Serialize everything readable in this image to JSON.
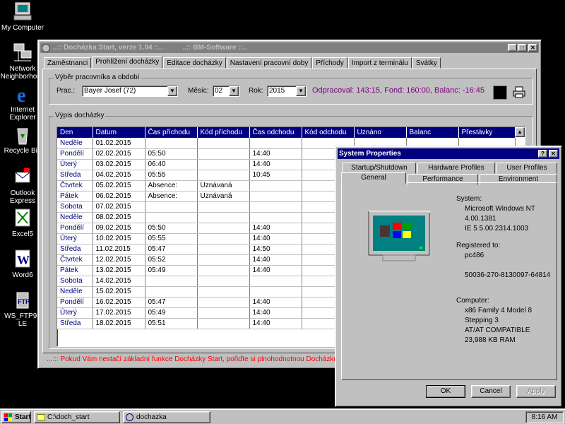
{
  "desktop": {
    "icons": [
      {
        "label": "My Computer"
      },
      {
        "label": "Network Neighborhood"
      },
      {
        "label": "Internet Explorer"
      },
      {
        "label": "Recycle Bin"
      },
      {
        "label": "Outlook Express"
      },
      {
        "label": "Excel5"
      },
      {
        "label": "Word6"
      },
      {
        "label": "WS_FTP95 LE"
      }
    ]
  },
  "main_window": {
    "title": "..:: Docházka Start, verze 1.04 ::..          ..:: BM-Software ::..",
    "tabs": [
      "Zaměstnanci",
      "Prohlížení docházky",
      "Editace docházky",
      "Nastavení pracovní doby",
      "Příchody",
      "Import z terminálu",
      "Svátky"
    ],
    "active_tab": 1,
    "selection_group": {
      "legend": "Výběr pracovníka a období",
      "employee_label": "Prac.:",
      "employee_value": "Bayer Josef (72)",
      "month_label": "Měsíc:",
      "month_value": "02",
      "year_label": "Rok:",
      "year_value": "2015",
      "summary": "Odpracoval: 143:15, Fond: 160:00, Balanc: -16:45"
    },
    "listing_group": {
      "legend": "Výpis docházky",
      "columns": [
        "Den",
        "Datum",
        "Čas příchodu",
        "Kód příchodu",
        "Čas odchodu",
        "Kód odchodu",
        "Uznáno",
        "Balanc",
        "Přestávky"
      ],
      "rows": [
        [
          "Neděle",
          "01.02.2015",
          "",
          "",
          "",
          "",
          "",
          "",
          ""
        ],
        [
          "Pondělí",
          "02.02.2015",
          "05:50",
          "",
          "14:40",
          "",
          "",
          "",
          ""
        ],
        [
          "Úterý",
          "03.02.2015",
          "06:40",
          "",
          "14:40",
          "",
          "",
          "",
          ""
        ],
        [
          "Středa",
          "04.02.2015",
          "05:55",
          "",
          "10:45",
          "",
          "",
          "",
          ""
        ],
        [
          "Čtvrtek",
          "05.02.2015",
          "Absence:",
          "Uznávaná",
          "",
          "",
          "",
          "",
          ""
        ],
        [
          "Pátek",
          "06.02.2015",
          "Absence:",
          "Uznávaná",
          "",
          "",
          "",
          "",
          ""
        ],
        [
          "Sobota",
          "07.02.2015",
          "",
          "",
          "",
          "",
          "",
          "",
          ""
        ],
        [
          "Neděle",
          "08.02.2015",
          "",
          "",
          "",
          "",
          "",
          "",
          ""
        ],
        [
          "Pondělí",
          "09.02.2015",
          "05:50",
          "",
          "14:40",
          "",
          "",
          "",
          ""
        ],
        [
          "Úterý",
          "10.02.2015",
          "05:55",
          "",
          "14:40",
          "",
          "",
          "",
          ""
        ],
        [
          "Středa",
          "11.02.2015",
          "05:47",
          "",
          "14:50",
          "",
          "",
          "",
          ""
        ],
        [
          "Čtvrtek",
          "12.02.2015",
          "05:52",
          "",
          "14:40",
          "",
          "",
          "",
          ""
        ],
        [
          "Pátek",
          "13.02.2015",
          "05:49",
          "",
          "14:40",
          "",
          "",
          "",
          ""
        ],
        [
          "Sobota",
          "14.02.2015",
          "",
          "",
          "",
          "",
          "",
          "",
          ""
        ],
        [
          "Neděle",
          "15.02.2015",
          "",
          "",
          "",
          "",
          "",
          "",
          ""
        ],
        [
          "Pondělí",
          "16.02.2015",
          "05:47",
          "",
          "14:40",
          "",
          "",
          "",
          ""
        ],
        [
          "Úterý",
          "17.02.2015",
          "05:49",
          "",
          "14:40",
          "",
          "",
          "",
          ""
        ],
        [
          "Středa",
          "18.02.2015",
          "05:51",
          "",
          "14:40",
          "",
          "",
          "",
          ""
        ]
      ]
    },
    "footer_note": "Pokud Vám nestačí základní funkce Docházky Start, pořiďte si plnohodnotnou Docházku 3000 na web"
  },
  "system_properties": {
    "title": "System Properties",
    "tabs_back": [
      "Startup/Shutdown",
      "Hardware Profiles",
      "User Profiles"
    ],
    "tabs_front": [
      "General",
      "Performance",
      "Environment"
    ],
    "system_label": "System:",
    "system_lines": [
      "Microsoft Windows NT",
      "4.00.1381",
      "IE 5 5.00.2314.1003"
    ],
    "registered_label": "Registered to:",
    "registered_lines": [
      "pc486",
      "",
      "50036-270-8130097-64814"
    ],
    "computer_label": "Computer:",
    "computer_lines": [
      "x86 Family 4 Model 8 Stepping 3",
      "AT/AT COMPATIBLE",
      "23,988 KB RAM"
    ],
    "ok_label": "OK",
    "cancel_label": "Cancel",
    "apply_label": "Apply"
  },
  "taskbar": {
    "start_label": "Start",
    "tasks": [
      "C:\\doch_start",
      "dochazka"
    ],
    "clock": "8:16 AM"
  }
}
